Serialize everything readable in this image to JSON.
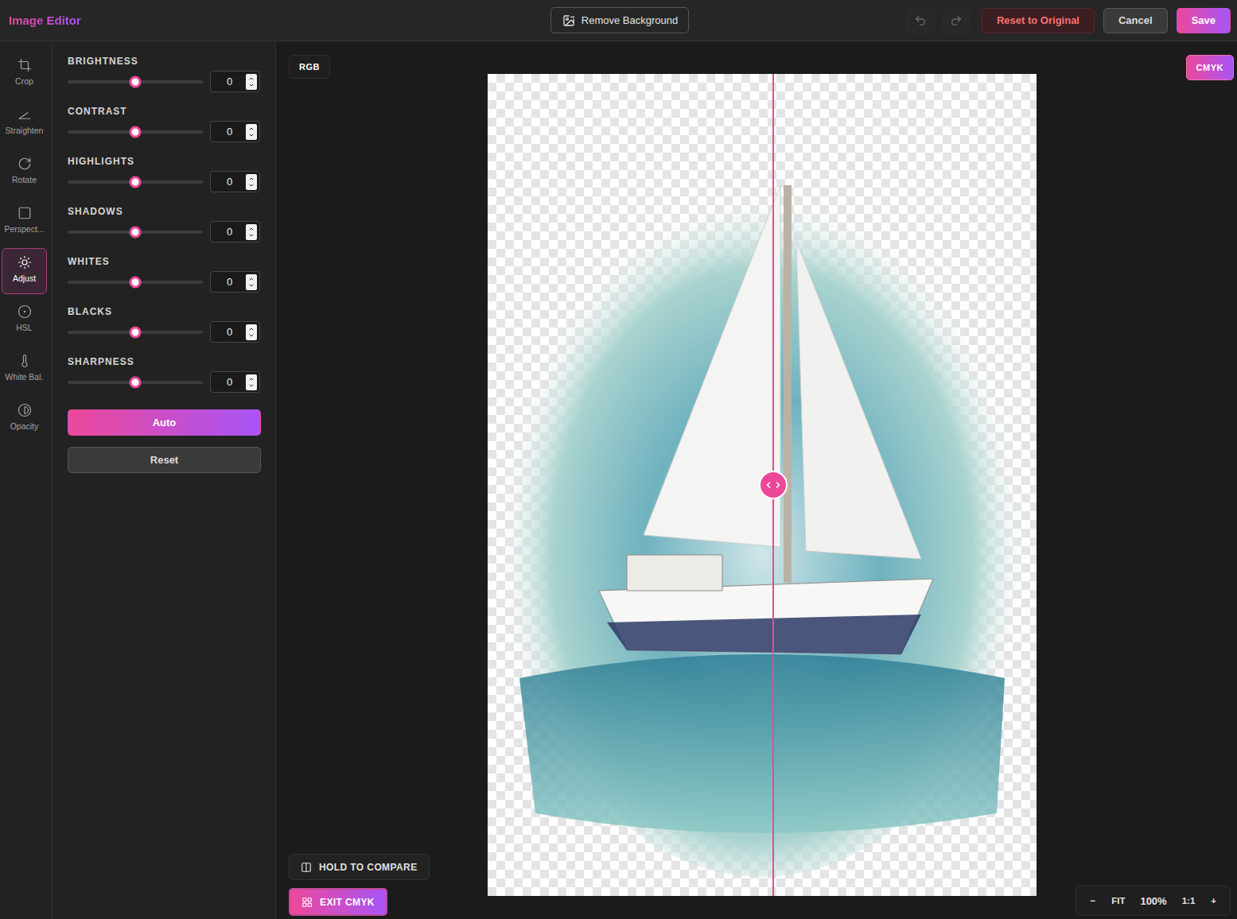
{
  "header": {
    "title": "Image Editor",
    "remove_background": "Remove Background",
    "undo": {
      "disabled": true
    },
    "redo": {
      "disabled": true
    },
    "buttons": [
      {
        "label": "Reset to Original",
        "kind": "danger"
      },
      {
        "label": "Cancel",
        "kind": "secondary"
      },
      {
        "label": "Save",
        "kind": "primary"
      }
    ]
  },
  "tools": [
    {
      "label": "Crop",
      "selected": false
    },
    {
      "label": "Straighten",
      "selected": false
    },
    {
      "label": "Rotate",
      "selected": false
    },
    {
      "label": "Perspect...",
      "selected": false
    },
    {
      "label": "Adjust",
      "selected": true
    },
    {
      "label": "HSL",
      "selected": false
    },
    {
      "label": "White Bal.",
      "selected": false
    },
    {
      "label": "Opacity",
      "selected": false
    }
  ],
  "adjustments": [
    {
      "label": "BRIGHTNESS",
      "value": "0",
      "level": 0.5
    },
    {
      "label": "CONTRAST",
      "value": "0",
      "level": 0.5
    },
    {
      "label": "HIGHLIGHTS",
      "value": "0",
      "level": 0.5
    },
    {
      "label": "SHADOWS",
      "value": "0",
      "level": 0.5
    },
    {
      "label": "WHITES",
      "value": "0",
      "level": 0.5
    },
    {
      "label": "BLACKS",
      "value": "0",
      "level": 0.5
    },
    {
      "label": "SHARPNESS",
      "value": "0",
      "level": 0.5
    }
  ],
  "panel_buttons": [
    {
      "label": "Auto",
      "kind": "primary"
    },
    {
      "label": "Reset",
      "kind": "secondary"
    }
  ],
  "canvas": {
    "left_badge": "RGB",
    "right_badge": "CMYK",
    "split": 0.52
  },
  "compare_button": "HOLD TO COMPARE",
  "exit_button": "EXIT CMYK",
  "zoom": [
    {
      "label": "−",
      "kind": "button"
    },
    {
      "label": "FIT",
      "kind": "button"
    },
    {
      "label": "100%",
      "kind": "readout"
    },
    {
      "label": "1:1",
      "kind": "button"
    },
    {
      "label": "+",
      "kind": "button"
    }
  ]
}
